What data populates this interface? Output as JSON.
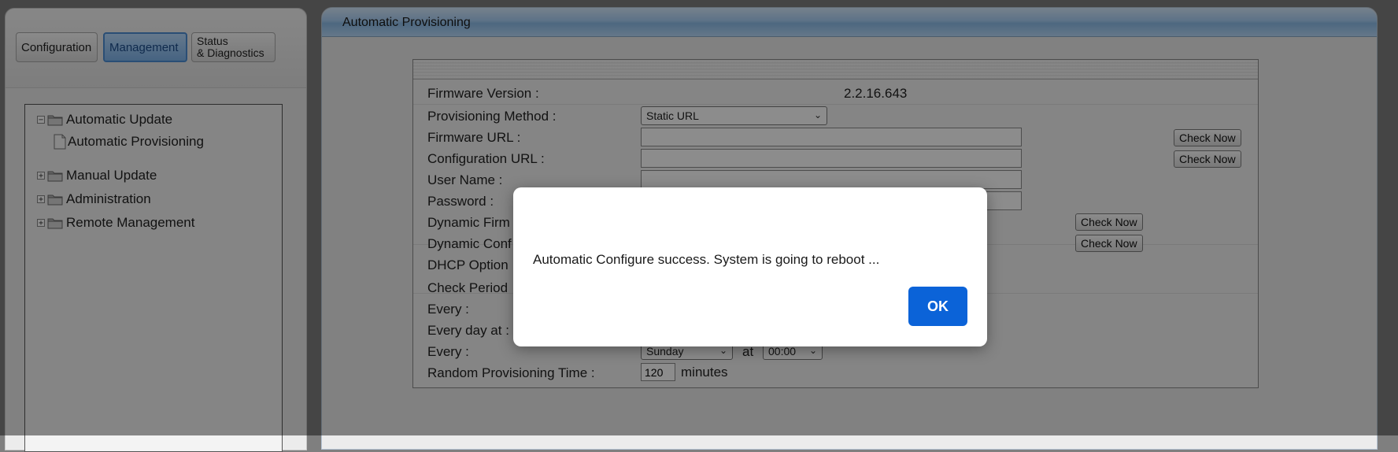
{
  "tabs": [
    {
      "label": "Configuration"
    },
    {
      "label": "Management"
    },
    {
      "label_line1": "Status",
      "label_line2": "& Diagnostics"
    }
  ],
  "tree": {
    "automatic_update": "Automatic Update",
    "automatic_provisioning": "Automatic Provisioning",
    "manual_update": "Manual Update",
    "administration": "Administration",
    "remote_management": "Remote Management"
  },
  "panel": {
    "title": "Automatic Provisioning"
  },
  "form": {
    "firmware_version_label": "Firmware Version :",
    "firmware_version_value": "2.2.16.643",
    "provisioning_method_label": "Provisioning Method :",
    "provisioning_method_value": "Static URL",
    "firmware_url_label": "Firmware URL :",
    "configuration_url_label": "Configuration URL :",
    "user_name_label": "User Name :",
    "password_label": "Password :",
    "dynamic_firmware_label": "Dynamic Firm",
    "dynamic_config_label": "Dynamic Conf",
    "dhcp_option_label": "DHCP Option",
    "check_period_label": "Check Period",
    "every_label": "Every :",
    "every_day_at_label": "Every day at :",
    "every_week_label": "Every :",
    "weekday_value": "Sunday",
    "at_label": "at",
    "time_value": "00:00",
    "random_time_label": "Random Provisioning Time :",
    "random_time_value": "120",
    "minutes_label": "minutes",
    "check_now_label": "Check Now"
  },
  "dialog": {
    "message": "Automatic Configure success. System is going to reboot ...",
    "ok_label": "OK"
  },
  "colors": {
    "ok_button": "#0b63d8",
    "active_tab": "#7fb5ec"
  }
}
